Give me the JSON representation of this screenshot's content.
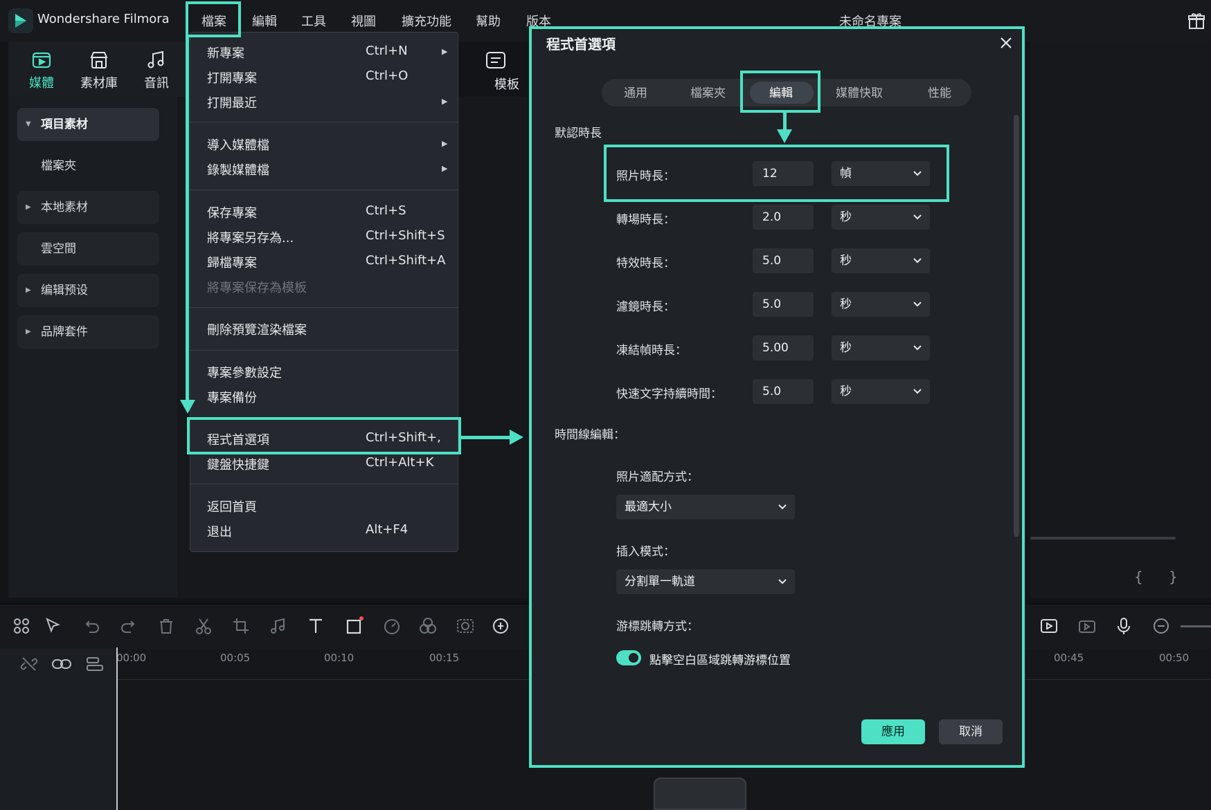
{
  "app": {
    "title": "Wondershare Filmora",
    "project_title": "未命名專案"
  },
  "menubar": [
    "檔案",
    "編輯",
    "工具",
    "視圖",
    "擴充功能",
    "幫助",
    "版本"
  ],
  "toolbar": {
    "tabs": [
      {
        "label": "媒體"
      },
      {
        "label": "素材庫"
      },
      {
        "label": "音訊"
      }
    ],
    "partial_label": "模板"
  },
  "sidebar": {
    "items": [
      {
        "label": "項目素材"
      },
      {
        "label": "檔案夾"
      },
      {
        "label": "本地素材"
      },
      {
        "label": "雲空間"
      },
      {
        "label": "编辑预设"
      },
      {
        "label": "品牌套件"
      }
    ]
  },
  "file_menu": {
    "items": [
      {
        "label": "新專案",
        "shortcut": "Ctrl+N",
        "submenu": true
      },
      {
        "label": "打開專案",
        "shortcut": "Ctrl+O"
      },
      {
        "label": "打開最近",
        "submenu": true
      },
      {
        "label": "導入媒體檔",
        "submenu": true
      },
      {
        "label": "錄製媒體檔",
        "submenu": true
      },
      {
        "label": "保存專案",
        "shortcut": "Ctrl+S"
      },
      {
        "label": "將專案另存為...",
        "shortcut": "Ctrl+Shift+S"
      },
      {
        "label": "歸檔專案",
        "shortcut": "Ctrl+Shift+A"
      },
      {
        "label": "將專案保存為模板",
        "disabled": true
      },
      {
        "label": "刪除預覽渲染檔案"
      },
      {
        "label": "專案參數設定"
      },
      {
        "label": "專案備份"
      },
      {
        "label": "程式首選項",
        "shortcut": "Ctrl+Shift+,"
      },
      {
        "label": "鍵盤快捷鍵",
        "shortcut": "Ctrl+Alt+K"
      },
      {
        "label": "返回首頁"
      },
      {
        "label": "退出",
        "shortcut": "Alt+F4"
      }
    ]
  },
  "preferences": {
    "title": "程式首選項",
    "tabs": [
      "通用",
      "檔案夾",
      "編輯",
      "媒體快取",
      "性能"
    ],
    "active_tab": "編輯",
    "default_duration_heading": "默認時長",
    "durations": [
      {
        "label": "照片時長：",
        "value": "12",
        "unit": "幀"
      },
      {
        "label": "轉場時長：",
        "value": "2.0",
        "unit": "秒"
      },
      {
        "label": "特效時長：",
        "value": "5.0",
        "unit": "秒"
      },
      {
        "label": "濾鏡時長：",
        "value": "5.0",
        "unit": "秒"
      },
      {
        "label": "凍結幀時長：",
        "value": "5.00",
        "unit": "秒"
      },
      {
        "label": "快速文字持續時間：",
        "value": "5.0",
        "unit": "秒"
      }
    ],
    "timeline_heading": "時間線編輯：",
    "photo_fit_label": "照片適配方式：",
    "photo_fit_value": "最適大小",
    "insert_mode_label": "插入模式：",
    "insert_mode_value": "分割單一軌道",
    "cursor_jump_label": "游標跳轉方式：",
    "cursor_jump_option": "點擊空白區域跳轉游標位置",
    "cursor_jump_enabled": true,
    "apply_label": "應用",
    "cancel_label": "取消"
  },
  "timeline": {
    "ruler": [
      "00:00",
      "00:05",
      "00:10",
      "00:15",
      "00:45",
      "00:50"
    ]
  },
  "colors": {
    "highlight": "#4de0c4",
    "accent": "#4de0c4",
    "background": "#121418"
  }
}
